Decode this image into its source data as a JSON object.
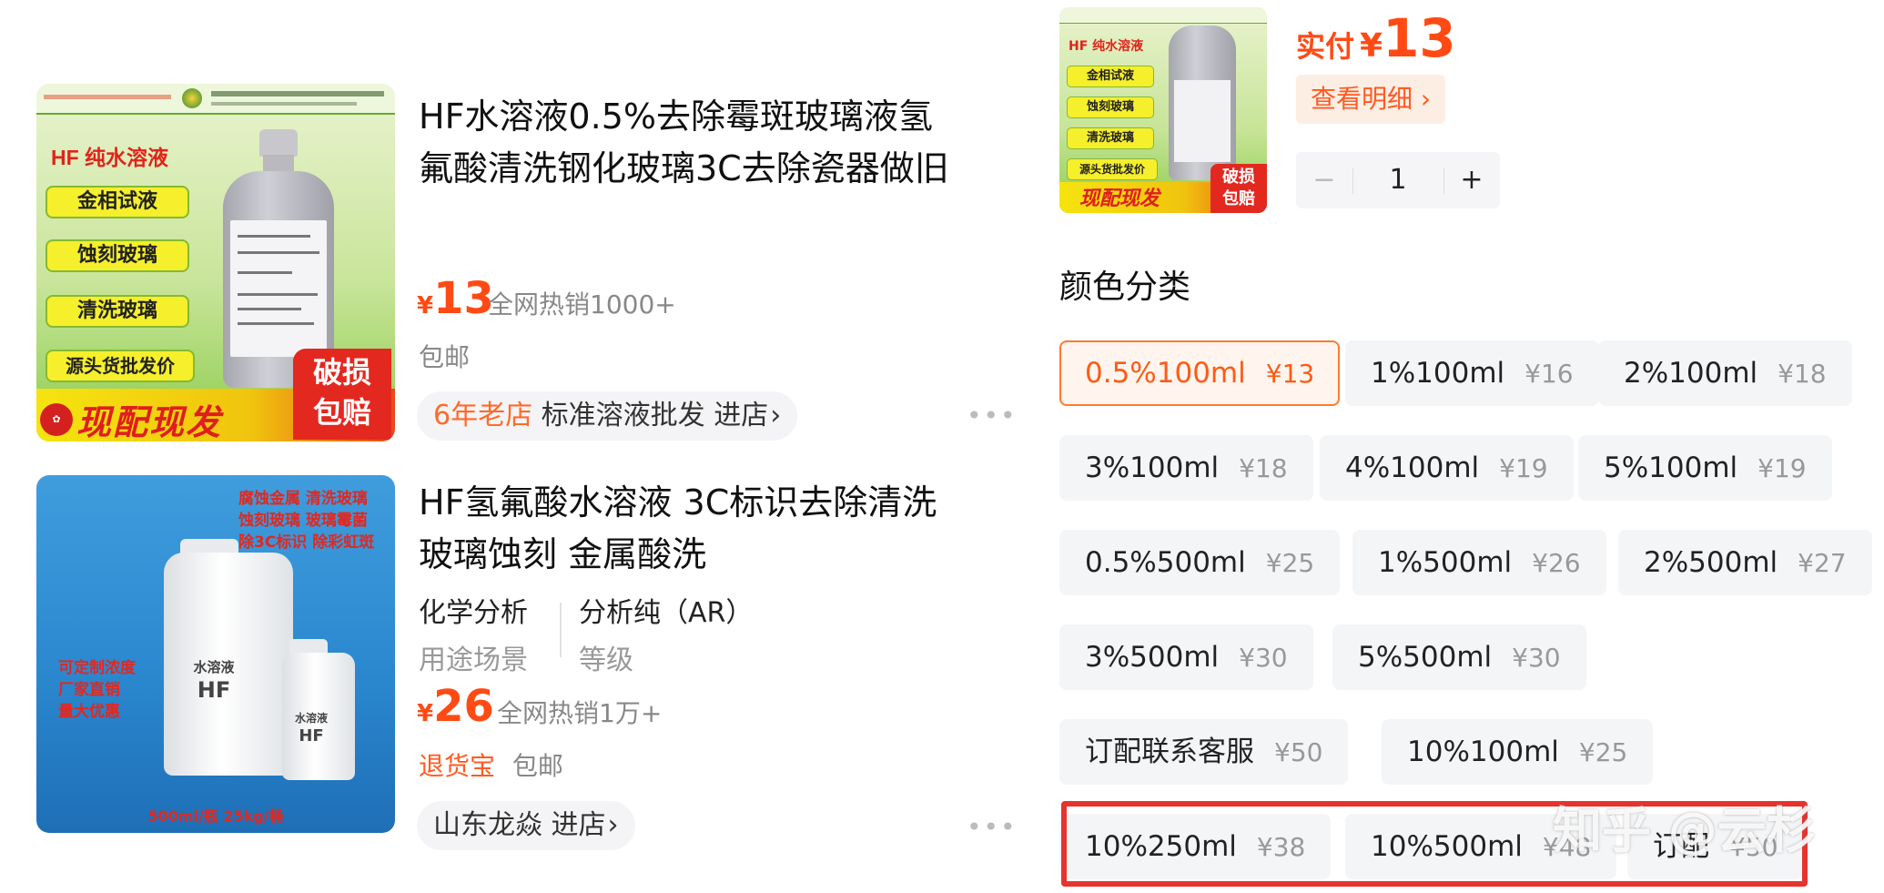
{
  "listings": [
    {
      "image": {
        "title": "HF 纯水溶液",
        "badges": [
          "金相试液",
          "蚀刻玻璃",
          "清洗玻璃",
          "源头货批发价"
        ],
        "footer": "现配现发",
        "broken_top": "破损",
        "broken_bottom": "包赔"
      },
      "title_line1": "HF水溶液0.5%去除霉斑玻璃液氢",
      "title_line2": "氟酸清洗钢化玻璃3C去除瓷器做旧",
      "price_symbol": "¥",
      "price": "13",
      "sold": "全网热销1000+",
      "shipping": "包邮",
      "shop_age": "6年老店",
      "shop_name": "标准溶液批发",
      "enter_shop": "进店",
      "more": "•••"
    },
    {
      "image": {
        "red_text_1": "腐蚀金属 清洗玻璃",
        "red_text_2": "蚀刻玻璃 玻璃霉菌",
        "red_text_3": "除3C标识 除彩虹斑",
        "left_text_1": "可定制浓度",
        "left_text_2": "厂家直销",
        "left_text_3": "量大优惠",
        "big_label": "水溶液",
        "big_hf": "HF",
        "small_label": "水溶液",
        "small_hf": "HF",
        "footer": "500ml/瓶 25kg/桶"
      },
      "title_line1": "HF氢氟酸水溶液 3C标识去除清洗",
      "title_line2": "玻璃蚀刻 金属酸洗",
      "spec1_value": "化学分析",
      "spec1_name": "用途场景",
      "spec2_value": "分析纯（AR）",
      "spec2_name": "等级",
      "price_symbol": "¥",
      "price": "26",
      "sold": "全网热销1万+",
      "refund": "退货宝",
      "shipping": "包邮",
      "shop_name": "山东龙焱",
      "enter_shop": "进店",
      "more": "•••"
    }
  ],
  "sku_panel": {
    "thumb": {
      "title": "HF 纯水溶液",
      "badges": [
        "金相试液",
        "蚀刻玻璃",
        "清洗玻璃",
        "源头货批发价"
      ],
      "footer": "现配现发",
      "broken_top": "破损",
      "broken_bottom": "包赔"
    },
    "paid_label": "实付",
    "paid_symbol": "¥",
    "paid_value": "13",
    "detail_button": "查看明细 ›",
    "quantity": "1",
    "minus": "−",
    "plus": "+",
    "section_title": "颜色分类",
    "options": [
      {
        "name": "0.5%100ml",
        "price": "¥13",
        "selected": true
      },
      {
        "name": "1%100ml",
        "price": "¥16"
      },
      {
        "name": "2%100ml",
        "price": "¥18"
      },
      {
        "name": "3%100ml",
        "price": "¥18"
      },
      {
        "name": "4%100ml",
        "price": "¥19"
      },
      {
        "name": "5%100ml",
        "price": "¥19"
      },
      {
        "name": "0.5%500ml",
        "price": "¥25"
      },
      {
        "name": "1%500ml",
        "price": "¥26"
      },
      {
        "name": "2%500ml",
        "price": "¥27"
      },
      {
        "name": "3%500ml",
        "price": "¥30"
      },
      {
        "name": "5%500ml",
        "price": "¥30"
      },
      {
        "name": "订配联系客服",
        "price": "¥50"
      },
      {
        "name": "10%100ml",
        "price": "¥25"
      },
      {
        "name": "10%250ml",
        "price": "¥38"
      },
      {
        "name": "10%500ml",
        "price": "¥48"
      },
      {
        "name": "订配",
        "price": "¥50"
      }
    ]
  },
  "watermark": "知乎 @云杉",
  "colors": {
    "accent": "#ff4a14",
    "highlight_box": "#e7332d"
  }
}
